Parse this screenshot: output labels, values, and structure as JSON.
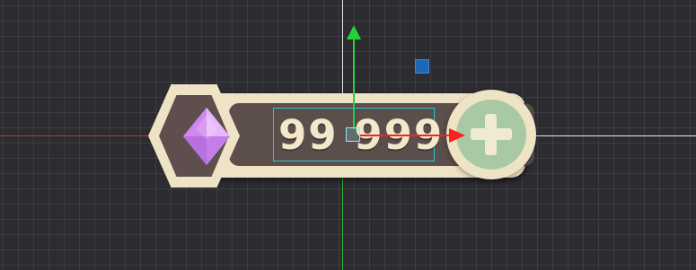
{
  "scene": {
    "background_color": "#2c2c31",
    "grid_color": "rgba(255,255,255,0.07)"
  },
  "currency_widget": {
    "amount": "99 999",
    "gem_icon": "diamond-gem-icon",
    "add_icon": "plus-icon",
    "colors": {
      "frame": "#efe3c6",
      "panel": "#5b4e4b",
      "gem": "#d79cf3",
      "add_button": "#a8c9a3",
      "text": "#f3e8cb"
    }
  },
  "gizmo": {
    "x_axis_color": "#ff1f1f",
    "y_axis_color": "#23d33a",
    "handle_color": "#1d69b8",
    "selection_color": "#25c8d6"
  }
}
